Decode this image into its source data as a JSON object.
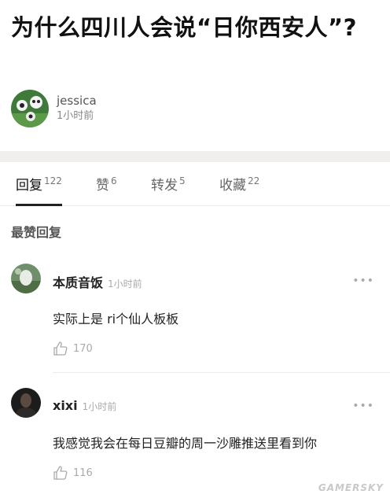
{
  "post": {
    "title": "为什么四川人会说“日你西安人”?",
    "author": "jessica",
    "time": "1小时前"
  },
  "tabs": [
    {
      "label": "回复",
      "count": "122",
      "active": true
    },
    {
      "label": "赞",
      "count": "6",
      "active": false
    },
    {
      "label": "转发",
      "count": "5",
      "active": false
    },
    {
      "label": "收藏",
      "count": "22",
      "active": false
    }
  ],
  "section_label": "最赞回复",
  "comments": [
    {
      "name": "本质音饭",
      "time": "1小时前",
      "text": "实际上是 ri个仙人板板",
      "likes": "170",
      "more": "•••"
    },
    {
      "name": "xixi",
      "time": "1小时前",
      "text": "我感觉我会在每日豆瓣的周一沙雕推送里看到你",
      "likes": "116",
      "more": "•••"
    }
  ],
  "watermark": "GAMERSKY",
  "colors": {
    "band": "#f0efed",
    "active_tab": "#111111",
    "muted": "#aaaaaa"
  },
  "icons": [
    "thumb-up-icon",
    "more-dots-icon"
  ]
}
